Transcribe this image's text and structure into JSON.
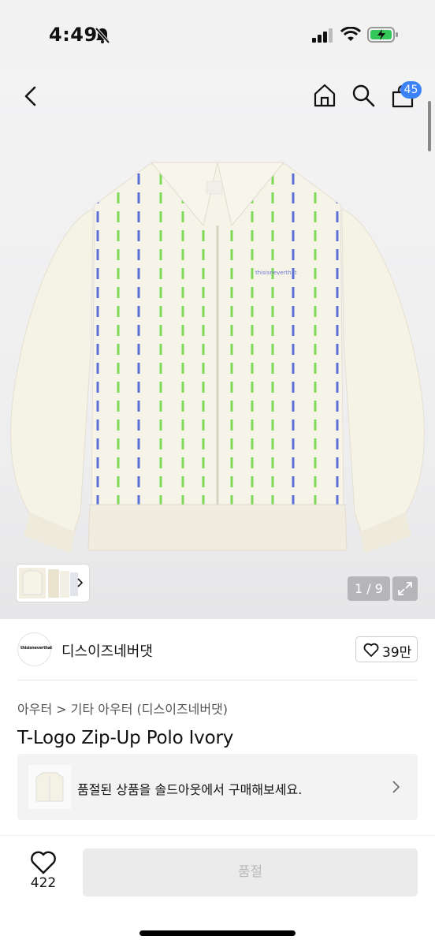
{
  "status_bar": {
    "time": "4:49"
  },
  "nav": {
    "cart_count": "45"
  },
  "product_image": {
    "counter": "1 / 9",
    "chest_logo_text": "thisisneverthat"
  },
  "brand": {
    "name": "디스이즈네버댓",
    "logo_text": "thisisneverthat",
    "likes": "39만"
  },
  "breadcrumb": "아우터 > 기타 아우터 (디스이즈네버댓)",
  "product": {
    "title": "T-Logo Zip-Up Polo Ivory"
  },
  "sold_out_banner": {
    "text": "품절된 상품을 솔드아웃에서 구매해보세요."
  },
  "bottom_bar": {
    "like_count": "422",
    "action_label": "품절"
  },
  "colors": {
    "accent_badge": "#3b82f6",
    "stripe_blue": "#5b6fd6",
    "stripe_green": "#7ed957",
    "knit_ivory": "#f5f2e6"
  }
}
